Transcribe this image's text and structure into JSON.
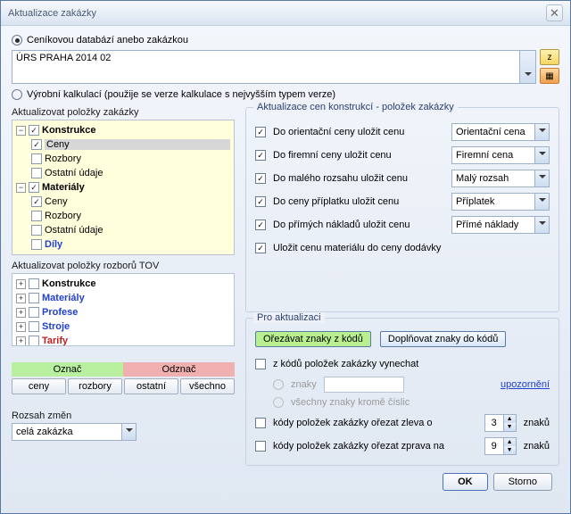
{
  "window": {
    "title": "Aktualizace zakázky"
  },
  "top": {
    "radio1": "Ceníkovou databází anebo zakázkou",
    "combo": "ÚRS PRAHA 2014 02",
    "radio2": "Výrobní kalkulací (použije se verze kalkulace s nejvyšším typem verze)"
  },
  "tree1": {
    "title": "Aktualizovat položky zakázky",
    "n": {
      "konstrukce": "Konstrukce",
      "ceny": "Ceny",
      "rozbory": "Rozbory",
      "ostatni": "Ostatní údaje",
      "materialy": "Materiály",
      "dily": "Díly"
    }
  },
  "tree2": {
    "title": "Aktualizovat položky rozborů TOV",
    "konstrukce": "Konstrukce",
    "materialy": "Materiály",
    "profese": "Profese",
    "stroje": "Stroje",
    "tarify": "Tarify"
  },
  "mid": {
    "oznac": "Označ",
    "odznac": "Odznač",
    "ceny": "ceny",
    "rozbory": "rozbory",
    "ostatni": "ostatní",
    "vsechno": "všechno",
    "rozsah": "Rozsah změn",
    "rozsahv": "celá zakázka"
  },
  "g1": {
    "legend": "Aktualizace cen konstrukcí - položek zakázky",
    "r": [
      {
        "l": "Do orientační ceny uložit cenu",
        "v": "Orientační cena"
      },
      {
        "l": "Do firemní ceny uložit cenu",
        "v": "Firemní cena"
      },
      {
        "l": "Do malého rozsahu uložit cenu",
        "v": "Malý rozsah"
      },
      {
        "l": "Do ceny příplatku uložit cenu",
        "v": "Příplatek"
      },
      {
        "l": "Do přímých nákladů uložit cenu",
        "v": "Přímé náklady"
      }
    ],
    "last": "Uložit cenu materiálu do ceny dodávky"
  },
  "g2": {
    "legend": "Pro aktualizaci",
    "btn1": "Ořezávat znaky z kódů",
    "btn2": "Doplňovat znaky do kódů",
    "c1": "z kódů položek zakázky vynechat",
    "c1a": "znaky",
    "c1b": "všechny znaky kromě číslic",
    "warn": "upozornění",
    "c2": "kódy položek zakázky ořezat zleva o",
    "c2v": "3",
    "c2u": "znaků",
    "c3": "kódy položek zakázky ořezat zprava na",
    "c3v": "9",
    "c3u": "znaků"
  },
  "foot": {
    "ok": "OK",
    "cancel": "Storno"
  }
}
